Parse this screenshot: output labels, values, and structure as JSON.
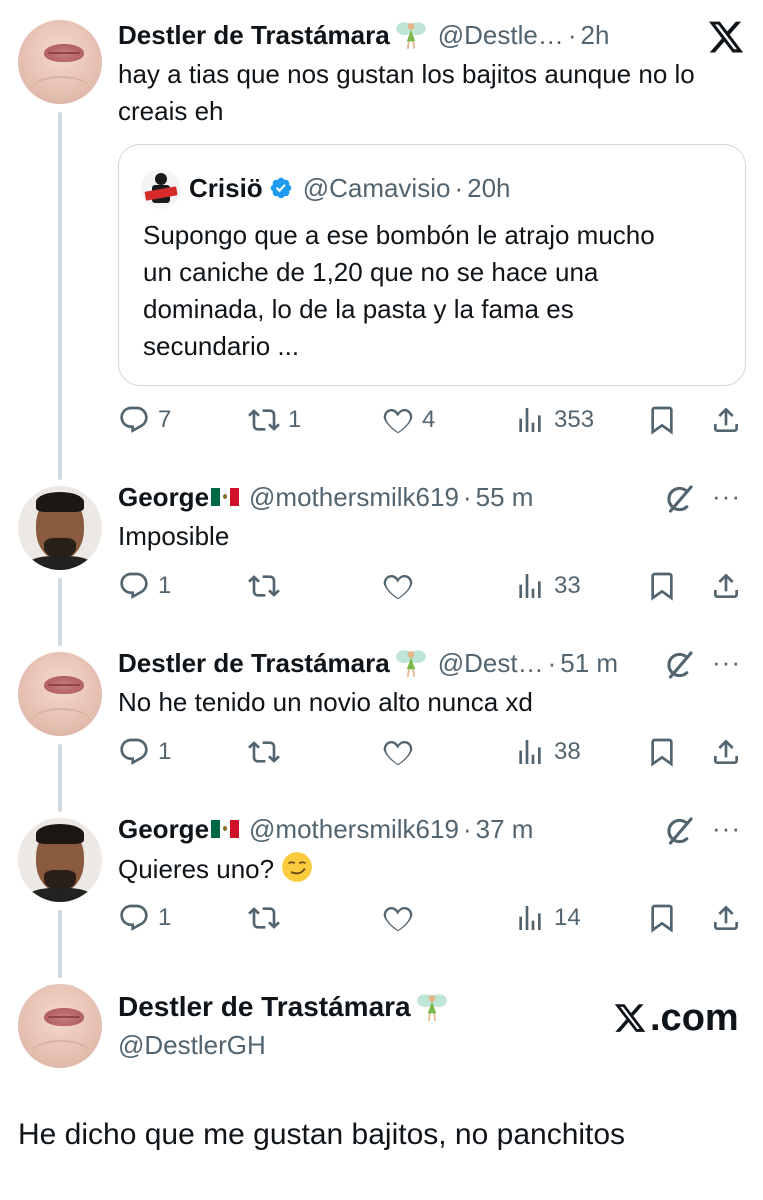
{
  "main_tweet": {
    "name": "Destler de Trastámara",
    "handle": "@Destle…",
    "time": "2h",
    "text_lines": [
      "hay a tias que nos gustan los bajitos aunque no lo",
      "creais eh"
    ],
    "quote": {
      "name": "Crisiö",
      "handle": "@Camavisio",
      "time": "20h",
      "text_lines": [
        "Supongo que a ese bombón le atrajo mucho",
        "un caniche de 1,20 que no se hace una",
        "dominada, lo de la pasta y la fama es",
        "secundario ..."
      ]
    },
    "replies": "7",
    "reposts": "1",
    "likes": "4",
    "views": "353"
  },
  "reply1": {
    "name": "George",
    "handle": "@mothersmilk619",
    "time": "55 m",
    "text": "Imposible",
    "replies": "1",
    "reposts": "",
    "likes": "",
    "views": "33"
  },
  "reply2": {
    "name": "Destler de Trastámara",
    "handle": "@Dest…",
    "time": "51 m",
    "text": "No he tenido un novio alto nunca xd",
    "replies": "1",
    "reposts": "",
    "likes": "",
    "views": "38"
  },
  "reply3": {
    "name": "George",
    "handle": "@mothersmilk619",
    "time": "37 m",
    "text": "Quieres uno?",
    "emoji": "smirk-emoji",
    "replies": "1",
    "reposts": "",
    "likes": "",
    "views": "14"
  },
  "footer": {
    "name": "Destler de Trastámara",
    "handle": "@DestlerGH",
    "brand": ".com"
  },
  "caption": "He dicho que me gustan bajitos, no panchitos",
  "separator": "·",
  "more": "···",
  "colors": {
    "text": "#0f1419",
    "secondary": "#536471",
    "border": "#cfd9de",
    "verified": "#1d9bf0"
  }
}
